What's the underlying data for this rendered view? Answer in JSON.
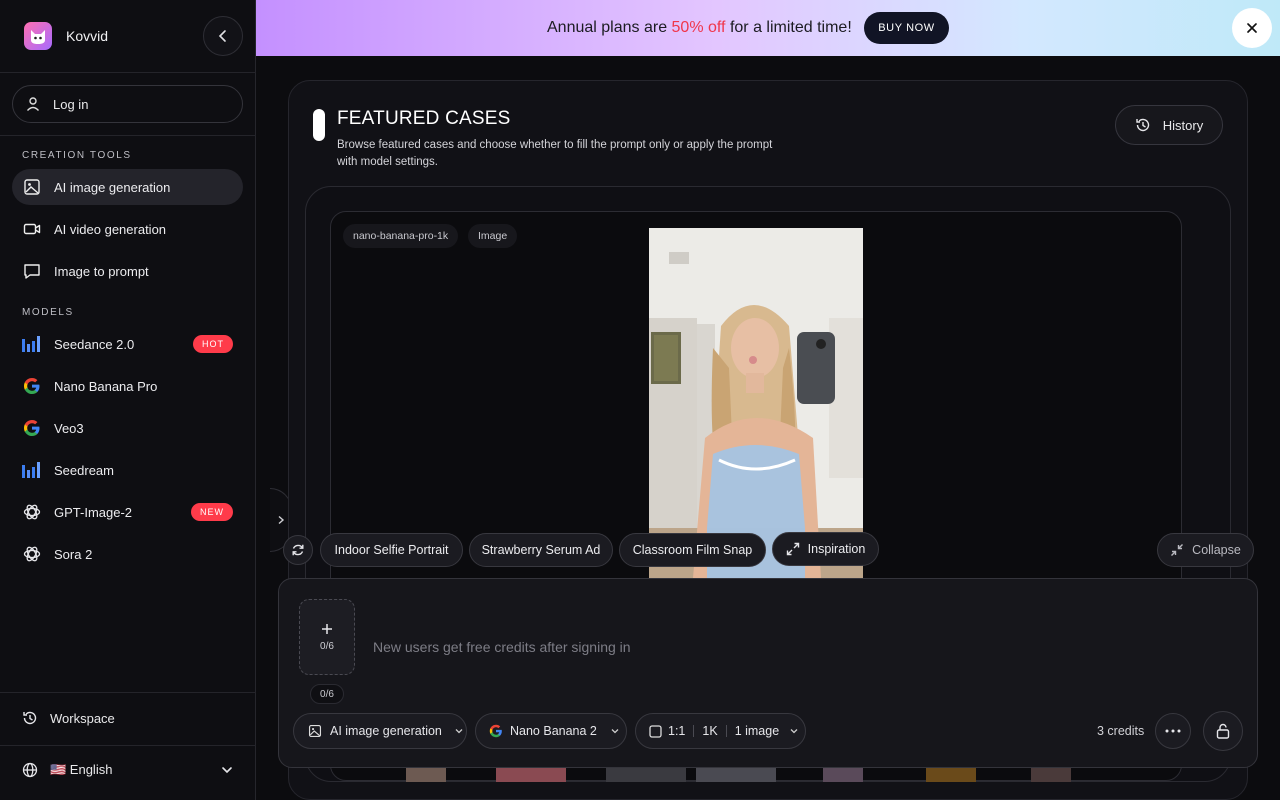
{
  "app": {
    "name": "Kovvid"
  },
  "sidebar": {
    "login_label": "Log in",
    "creation_title": "CREATION TOOLS",
    "creation_items": [
      {
        "label": "AI image generation",
        "icon": "image-icon",
        "active": true
      },
      {
        "label": "AI video generation",
        "icon": "video-icon"
      },
      {
        "label": "Image to prompt",
        "icon": "chat-icon"
      }
    ],
    "models_title": "MODELS",
    "models": [
      {
        "label": "Seedance 2.0",
        "icon": "bars-logo-icon",
        "badge": "HOT"
      },
      {
        "label": "Nano Banana Pro",
        "icon": "google-icon"
      },
      {
        "label": "Veo3",
        "icon": "google-icon"
      },
      {
        "label": "Seedream",
        "icon": "bars-logo-icon"
      },
      {
        "label": "GPT-Image-2",
        "icon": "openai-icon",
        "badge": "NEW"
      },
      {
        "label": "Sora 2",
        "icon": "openai-icon"
      }
    ],
    "workspace_label": "Workspace",
    "language_label": "🇺🇸 English"
  },
  "banner": {
    "text_before": "Annual plans are ",
    "highlight": "50% off",
    "text_after": " for a limited time!",
    "button": "BUY NOW"
  },
  "featured": {
    "title": "FEATURED CASES",
    "description": "Browse featured cases and choose whether to fill the prompt only or apply the prompt with model settings.",
    "history_label": "History",
    "tags": [
      "nano-banana-pro-1k",
      "Image"
    ],
    "chips": [
      "Indoor Selfie Portrait",
      "Strawberry Serum Ad",
      "Classroom Film Snap"
    ],
    "inspiration_label": "Inspiration",
    "collapse_label": "Collapse"
  },
  "prompt": {
    "upload_count": "0/6",
    "count_pill": "0/6",
    "placeholder": "New users get free credits after signing in",
    "mode_label": "AI image generation",
    "model_label": "Nano Banana 2",
    "ratio": "1:1",
    "resolution": "1K",
    "quantity": "1 image",
    "credits": "3 credits"
  },
  "colors": {
    "accent_red": "#f0364b",
    "badge_red": "#ff3b4a",
    "background": "#0c0c0f"
  }
}
